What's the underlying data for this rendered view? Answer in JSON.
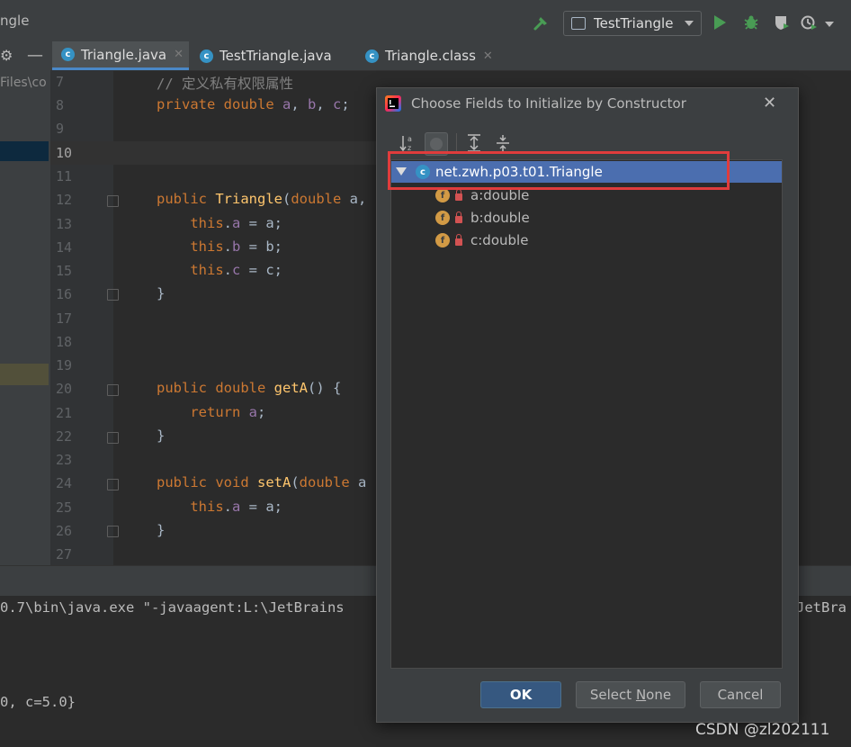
{
  "window": {
    "project_title": "ngle"
  },
  "toolbar": {
    "run_config": "TestTriangle",
    "icons": [
      "hammer-icon",
      "run-icon",
      "debug-icon",
      "coverage-icon",
      "profile-icon",
      "chevron-down-icon"
    ]
  },
  "tabs": [
    {
      "label": "Triangle.java",
      "active": true,
      "closable": true
    },
    {
      "label": "TestTriangle.java",
      "active": false,
      "closable": false
    },
    {
      "label": "Triangle.class",
      "active": false,
      "closable": true
    }
  ],
  "project_panel": {
    "path_fragment": "Files\\co"
  },
  "editor": {
    "line_numbers": [
      "7",
      "8",
      "9",
      "10",
      "11",
      "12",
      "13",
      "14",
      "15",
      "16",
      "17",
      "18",
      "19",
      "20",
      "21",
      "22",
      "23",
      "24",
      "25",
      "26",
      "27"
    ],
    "current_line": "10",
    "comment_text": "// 定义私有权限属性"
  },
  "run_output": {
    "line1": "0.7\\bin\\java.exe \"-javaagent:L:\\JetBrains",
    "line1_tail": "JetBra",
    "line2": "0, c=5.0}"
  },
  "dialog": {
    "title": "Choose Fields to Initialize by Constructor",
    "close_symbol": "✕",
    "root": {
      "label": "net.zwh.p03.t01.Triangle",
      "icon_letter": "c"
    },
    "fields": [
      {
        "label": "a:double",
        "icon_letter": "f"
      },
      {
        "label": "b:double",
        "icon_letter": "f"
      },
      {
        "label": "c:double",
        "icon_letter": "f"
      }
    ],
    "buttons": {
      "ok": "OK",
      "select_none_prefix": "Select ",
      "select_none_mnemonic": "N",
      "select_none_suffix": "one",
      "cancel": "Cancel"
    }
  },
  "colors": {
    "highlight": "#e03c3c",
    "selection": "#4b6eaf",
    "accent_tab": "#4a88c7"
  },
  "watermark": "CSDN @zl202111"
}
